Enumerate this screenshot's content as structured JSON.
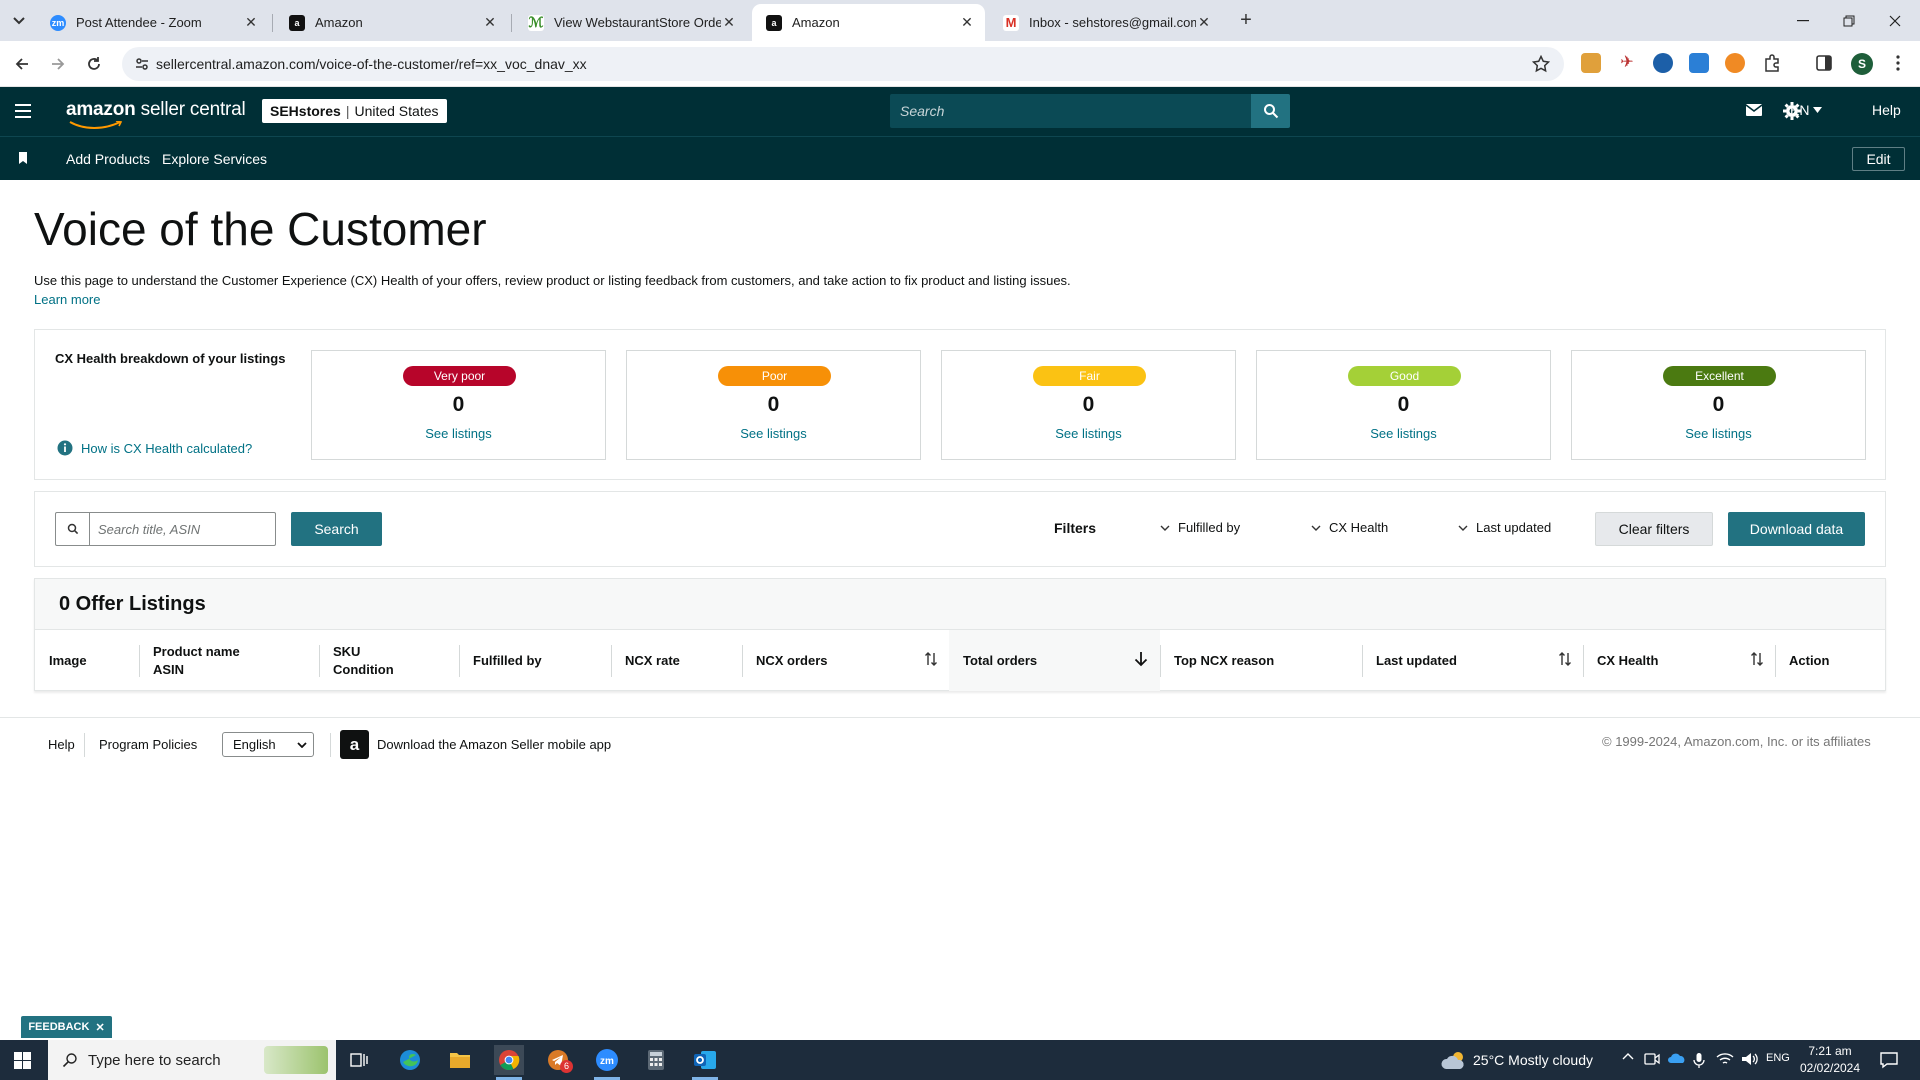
{
  "browser": {
    "tabs": [
      {
        "title": "Post Attendee - Zoom",
        "icon": "zoom-icon",
        "active": false
      },
      {
        "title": "Amazon",
        "icon": "amazon-icon",
        "active": false
      },
      {
        "title": "View WebstaurantStore Orders",
        "icon": "webstaurant-icon",
        "active": false
      },
      {
        "title": "Amazon",
        "icon": "amazon-icon",
        "active": true
      },
      {
        "title": "Inbox - sehstores@gmail.com -",
        "icon": "gmail-icon",
        "active": false
      }
    ],
    "url": "sellercentral.amazon.com/voice-of-the-customer/ref=xx_voc_dnav_xx",
    "profile_initial": "S"
  },
  "header": {
    "logo_text": "amazon",
    "logo_suffix": "seller central",
    "store_name": "SEHstores",
    "store_region": "United States",
    "search_placeholder": "Search",
    "language": "EN",
    "help": "Help"
  },
  "nav": {
    "links": [
      "Add Products",
      "Explore Services"
    ],
    "edit": "Edit"
  },
  "page": {
    "title": "Voice of the Customer",
    "intro": "Use this page to understand the Customer Experience (CX) Health of your offers, review product or listing feedback from customers, and take action to fix product and listing issues.",
    "learn_more": "Learn more"
  },
  "cx_health": {
    "title": "CX Health breakdown of your listings",
    "how_link": "How is CX Health calculated?",
    "cards": [
      {
        "label": "Very poor",
        "count": "0",
        "link": "See listings",
        "color": "#b7052a",
        "text_color": "#ffffff"
      },
      {
        "label": "Poor",
        "count": "0",
        "link": "See listings",
        "color": "#f79007",
        "text_color": "#ffffff"
      },
      {
        "label": "Fair",
        "count": "0",
        "link": "See listings",
        "color": "#fbc213",
        "text_color": "#ffffff"
      },
      {
        "label": "Good",
        "count": "0",
        "link": "See listings",
        "color": "#a4d037",
        "text_color": "#ffffff"
      },
      {
        "label": "Excellent",
        "count": "0",
        "link": "See listings",
        "color": "#4b7a11",
        "text_color": "#ffffff"
      }
    ]
  },
  "filters": {
    "search_placeholder": "Search title, ASIN",
    "search_button": "Search",
    "filters_label": "Filters",
    "selects": [
      "Fulfilled by",
      "CX Health",
      "Last updated"
    ],
    "clear_button": "Clear filters",
    "download_button": "Download data"
  },
  "listings": {
    "title": "0 Offer Listings",
    "columns": [
      {
        "line1": "Image",
        "line2": ""
      },
      {
        "line1": "Product name",
        "line2": "ASIN"
      },
      {
        "line1": "SKU",
        "line2": "Condition"
      },
      {
        "line1": "Fulfilled by",
        "line2": ""
      },
      {
        "line1": "NCX rate",
        "line2": ""
      },
      {
        "line1": "NCX orders",
        "line2": ""
      },
      {
        "line1": "Total orders",
        "line2": ""
      },
      {
        "line1": "Top NCX reason",
        "line2": ""
      },
      {
        "line1": "Last updated",
        "line2": ""
      },
      {
        "line1": "CX Health",
        "line2": ""
      },
      {
        "line1": "Action",
        "line2": ""
      }
    ],
    "rows": []
  },
  "footer": {
    "links": [
      "Help",
      "Program Policies"
    ],
    "language_select": "English",
    "app_text": "Download the Amazon Seller mobile app",
    "copyright": "© 1999-2024, Amazon.com, Inc. or its affiliates"
  },
  "feedback": "FEEDBACK",
  "taskbar": {
    "search_placeholder": "Type here to search",
    "weather": "25°C  Mostly cloudy",
    "lang": "ENG",
    "time": "7:21 am",
    "date": "02/02/2024",
    "badge_count": "6"
  }
}
